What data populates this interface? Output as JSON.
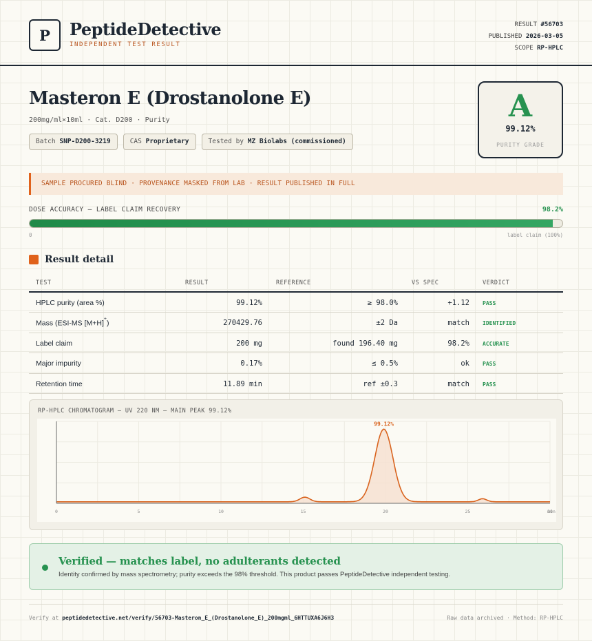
{
  "header": {
    "logo_letter": "P",
    "brand": "PeptideDetective",
    "tagline": "INDEPENDENT TEST RESULT",
    "result_label": "RESULT",
    "result_id": "#56703",
    "published_label": "PUBLISHED",
    "published_date": "2026-03-05",
    "scope_label": "SCOPE",
    "scope_value": "RP-HPLC"
  },
  "product": {
    "title": "Masteron E (Drostanolone E)",
    "subtitle": "200mg/ml×10ml · Cat. D200 · Purity",
    "chips": [
      {
        "label": "Batch",
        "value": "SNP-D200-3219"
      },
      {
        "label": "CAS",
        "value": "Proprietary"
      },
      {
        "label": "Tested by",
        "value": "MZ Biolabs (commissioned)"
      }
    ]
  },
  "grade": {
    "letter": "A",
    "value": "99.12%",
    "label": "PURITY GRADE"
  },
  "notice": "SAMPLE PROCURED BLIND · PROVENANCE MASKED FROM LAB · RESULT PUBLISHED IN FULL",
  "dose": {
    "label": "DOSE ACCURACY — LABEL CLAIM RECOVERY",
    "value_text": "98.2%",
    "fill_fraction": 0.982,
    "axis_zero": "0",
    "axis_claim": "label claim (100%)"
  },
  "section_title": "Result detail",
  "table": {
    "headers": {
      "test": "TEST",
      "result": "RESULT",
      "reference": "REFERENCE",
      "vs_spec": "VS SPEC",
      "verdict": "VERDICT"
    },
    "rows": [
      {
        "test": "HPLC purity (area %)",
        "sup": "",
        "result": "99.12%",
        "reference": "≥ 98.0%",
        "vs_spec": "+1.12",
        "verdict": "PASS"
      },
      {
        "test": "Mass (ESI-MS [M+H]",
        "sup": "+",
        "test_suffix": ")",
        "result": "270429.76",
        "reference": "±2 Da",
        "vs_spec": "match",
        "verdict": "IDENTIFIED"
      },
      {
        "test": "Label claim",
        "sup": "",
        "result": "200 mg",
        "reference": "found 196.40 mg",
        "vs_spec": "98.2%",
        "verdict": "ACCURATE"
      },
      {
        "test": "Major impurity",
        "sup": "",
        "result": "0.17%",
        "reference": "≤ 0.5%",
        "vs_spec": "ok",
        "verdict": "PASS"
      },
      {
        "test": "Retention time",
        "sup": "",
        "result": "11.89 min",
        "reference": "ref ±0.3",
        "vs_spec": "match",
        "verdict": "PASS"
      }
    ]
  },
  "chart_data": {
    "type": "line",
    "title": "RP-HPLC CHROMATOGRAM — UV 220 NM — MAIN PEAK 99.12%",
    "xlabel": "",
    "ylabel": "",
    "xlim": [
      0,
      30
    ],
    "ylim": [
      0,
      100
    ],
    "x_ticks": [
      "0",
      "5",
      "10",
      "15",
      "20",
      "25",
      "30"
    ],
    "x_unit_label": "min",
    "baseline": 2,
    "peaks": [
      {
        "center": 15.1,
        "height": 6,
        "width": 0.3
      },
      {
        "center": 19.9,
        "height": 95,
        "width": 0.55
      },
      {
        "center": 25.9,
        "height": 4,
        "width": 0.25
      }
    ],
    "annotation": {
      "x": 19.9,
      "text": "99.12%"
    },
    "line_color": "#d9641f",
    "fill_color": "#f6e1d1"
  },
  "verified": {
    "title": "Verified — matches label, no adulterants detected",
    "text": "Identity confirmed by mass spectrometry; purity exceeds the 98% threshold. This product passes PeptideDetective independent testing."
  },
  "footer": {
    "verify_prefix": "Verify at",
    "verify_url": "peptidedetective.net/verify/56703-Masteron_E_(Drostanolone_E)_200mgml_6HTTUXA6J6H3",
    "right": "Raw data archived · Method: RP-HPLC"
  },
  "colors": {
    "accent_orange": "#e0621b",
    "pass_green": "#279250",
    "ink": "#1d2733"
  }
}
